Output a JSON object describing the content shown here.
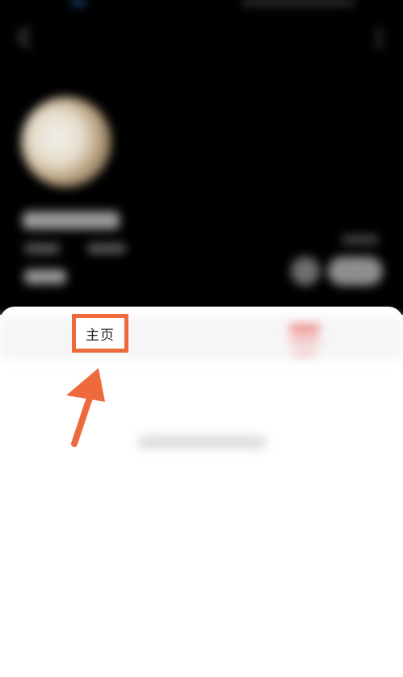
{
  "profile": {
    "home_tab_label": "主页"
  },
  "colors": {
    "header_background": "#000000",
    "highlight": "#ee6a3c",
    "accent_red": "#ef6b6b",
    "sheet_background": "#ffffff"
  },
  "icons": {
    "back": "back-arrow-icon",
    "more": "more-vertical-icon",
    "annotation_arrow": "pointer-arrow-icon"
  }
}
